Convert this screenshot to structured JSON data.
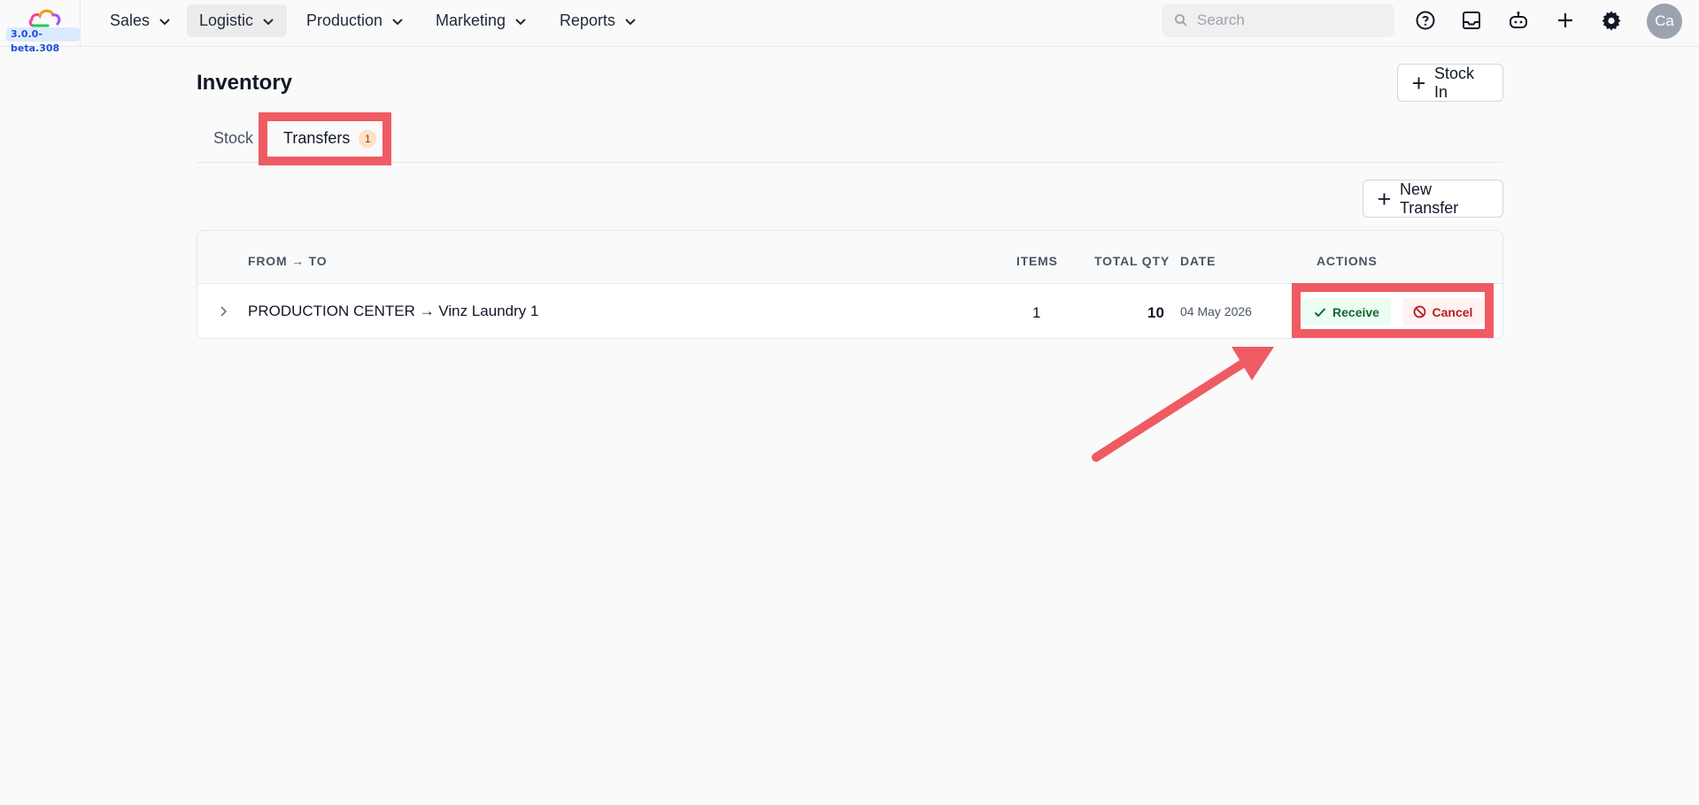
{
  "app": {
    "version": "3.0.0-beta.308"
  },
  "nav": {
    "items": [
      {
        "label": "Sales"
      },
      {
        "label": "Logistic"
      },
      {
        "label": "Production"
      },
      {
        "label": "Marketing"
      },
      {
        "label": "Reports"
      }
    ],
    "active": "Logistic"
  },
  "search": {
    "placeholder": "Search"
  },
  "toolbar_icons": [
    "help-icon",
    "inbox-icon",
    "bot-icon",
    "plus-icon",
    "gear-icon"
  ],
  "user": {
    "avatar_initials": "Ca"
  },
  "page": {
    "title": "Inventory",
    "stock_in_label": "Stock In",
    "tabs": [
      {
        "label": "Stock"
      },
      {
        "label": "Transfers",
        "badge": "1"
      }
    ],
    "active_tab": "Transfers",
    "new_transfer_label": "New Transfer"
  },
  "table": {
    "columns": {
      "from_to": "FROM → TO",
      "items": "ITEMS",
      "total_qty": "TOTAL QTY",
      "date": "DATE",
      "actions": "ACTIONS"
    },
    "rows": [
      {
        "from_to": "PRODUCTION CENTER → Vinz Laundry 1",
        "items": "1",
        "total_qty": "10",
        "date": "04 May 2026",
        "receive_label": "Receive",
        "cancel_label": "Cancel"
      }
    ]
  },
  "colors": {
    "highlight": "#ef5b63",
    "receive": "#166534",
    "cancel": "#b91c1c"
  }
}
